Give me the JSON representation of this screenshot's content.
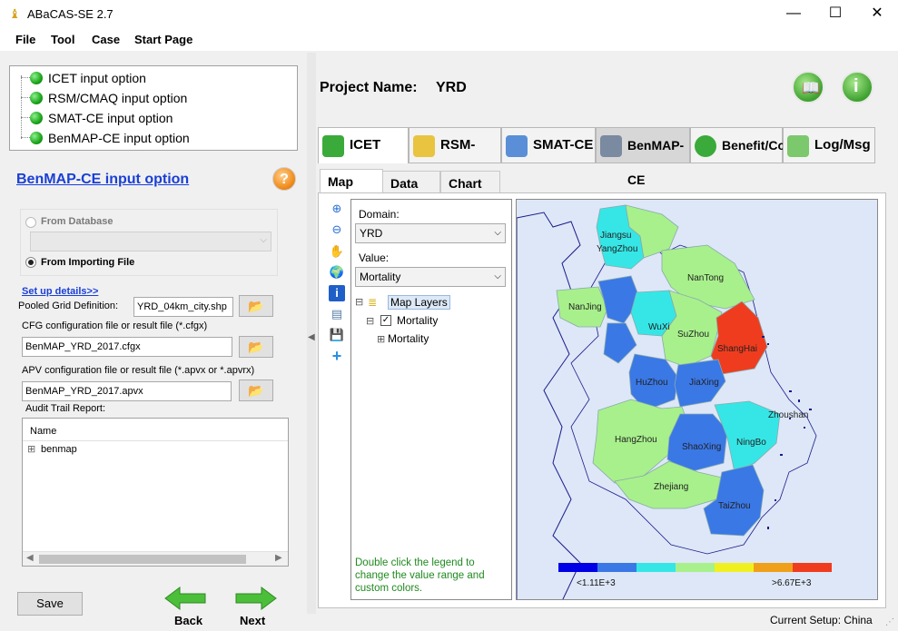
{
  "window": {
    "title": "ABaCAS-SE 2.7",
    "controls": [
      "—",
      "☐",
      "✕"
    ]
  },
  "menu": [
    "File",
    "Tool",
    "Case",
    "Start Page"
  ],
  "options": [
    "ICET input option",
    "RSM/CMAQ input option",
    "SMAT-CE input option",
    "BenMAP-CE input option"
  ],
  "section_title": "BenMAP-CE input option",
  "help_label": "?",
  "radio": {
    "from_database": "From Database",
    "from_importing": "From Importing File"
  },
  "setup_link": "Set up details>>",
  "pooled": {
    "label": "Pooled Grid Definition:",
    "value": "YRD_04km_city.shp"
  },
  "cfg": {
    "label": "CFG configuration file or result file (*.cfgx)",
    "value": "BenMAP_YRD_2017.cfgx"
  },
  "apv": {
    "label": "APV configuration file or result file (*.apvx or *.apvrx)",
    "value": "BenMAP_YRD_2017.apvx"
  },
  "audit": {
    "label": "Audit Trail Report:",
    "header": "Name",
    "item": "benmap",
    "expander": "⊞"
  },
  "buttons": {
    "save": "Save",
    "back": "Back",
    "next": "Next"
  },
  "project": {
    "label": "Project Name:",
    "value": "YRD"
  },
  "tabs": [
    "ICET",
    "RSM-VAT",
    "SMAT-CE",
    "BenMAP-CE",
    "Benefit/Cost",
    "Log/Msg"
  ],
  "subtabs": [
    "Map",
    "Data",
    "Chart"
  ],
  "domain": {
    "label": "Domain:",
    "value": "YRD"
  },
  "value": {
    "label": "Value:",
    "value": "Mortality"
  },
  "layers": {
    "root": "Map Layers",
    "layer": "Mortality",
    "sublayer": "Mortality",
    "expander_minus": "⊟",
    "expander_plus": "⊞"
  },
  "hint": "Double click the legend to change the value range and custom colors.",
  "legend": {
    "min": "<1.11E+3",
    "max": ">6.67E+3",
    "colors": [
      "#0000e6",
      "#3a78e6",
      "#36e6e6",
      "#a8f08c",
      "#f0f020",
      "#f0a018",
      "#f03c1e"
    ]
  },
  "cities": [
    "Jiangsu",
    "YangZhou",
    "NanTong",
    "NanJing",
    "WuXi",
    "SuZhou",
    "ShangHai",
    "HuZhou",
    "JiaXing",
    "Zhoushan",
    "HangZhou",
    "ShaoXing",
    "NingBo",
    "Zhejiang",
    "TaiZhou"
  ],
  "status": "Current Setup: China"
}
